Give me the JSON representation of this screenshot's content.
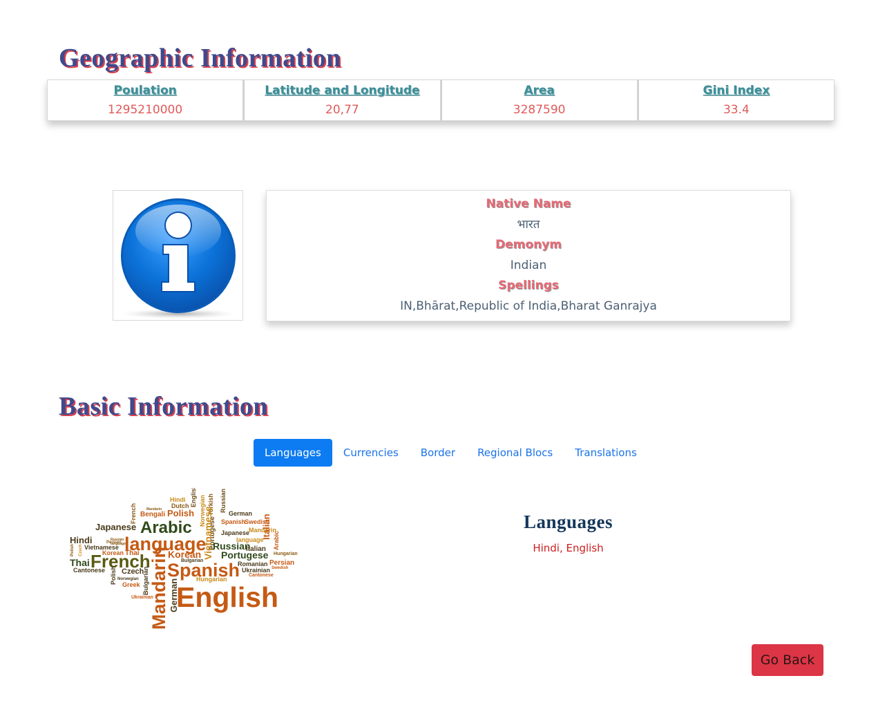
{
  "geographic": {
    "title": "Geographic Information",
    "stats": [
      {
        "label": "Poulation",
        "value": "1295210000"
      },
      {
        "label": "Latitude and Longitude",
        "value": "20,77"
      },
      {
        "label": "Area",
        "value": "3287590"
      },
      {
        "label": "Gini Index",
        "value": "33.4"
      }
    ]
  },
  "details": {
    "icon": "info-icon",
    "native_name_label": "Native Name",
    "native_name_value": "भारत",
    "demonym_label": "Demonym",
    "demonym_value": "Indian",
    "spellings_label": "Spellings",
    "spellings_value": "IN,Bhārat,Republic of India,Bharat Ganrajya"
  },
  "basic": {
    "title": "Basic Information",
    "tabs": [
      {
        "label": "Languages",
        "active": true
      },
      {
        "label": "Currencies",
        "active": false
      },
      {
        "label": "Border",
        "active": false
      },
      {
        "label": "Regional Blocs",
        "active": false
      },
      {
        "label": "Translations",
        "active": false
      }
    ],
    "wordcloud_image": "language-word-cloud",
    "wordcloud_words": [
      "Hindi",
      "Dutch",
      "English",
      "Russian",
      "Bengali",
      "Polish",
      "French",
      "Mandarin",
      "Norwegian",
      "Turkish",
      "Japanese",
      "Arabic",
      "Spanish",
      "Swedish",
      "German",
      "Hindi",
      "language",
      "Vietnamese",
      "Portugese",
      "Japanese",
      "Russian",
      "Italian",
      "Korean",
      "Thai",
      "Russian",
      "Vietnamese",
      "Portugese",
      "Persian",
      "Hungarian",
      "Thai",
      "French",
      "Spanish",
      "Romanian",
      "Ukrainian",
      "Czech",
      "Cantonese",
      "Polish",
      "Norwegian",
      "Mandarin",
      "Greek",
      "Bulgarian",
      "Hungarian",
      "German",
      "English",
      "Ukrainian",
      "Cantonese",
      "Swedish",
      "Italian",
      "Arabic",
      "Korean",
      "Persian",
      "Greek",
      "Czech",
      "language",
      "Bulgarian"
    ],
    "section_heading": "Languages",
    "section_value": "Hindi, English"
  },
  "actions": {
    "go_back_label": "Go Back"
  },
  "colors": {
    "title_text": "#3f4a8c",
    "title_shadow": "#d9404e",
    "stat_label": "#3b8f99",
    "stat_value": "#e05a5a",
    "tab_active_bg": "#0d7bf2",
    "go_back_bg": "#dc3545"
  }
}
